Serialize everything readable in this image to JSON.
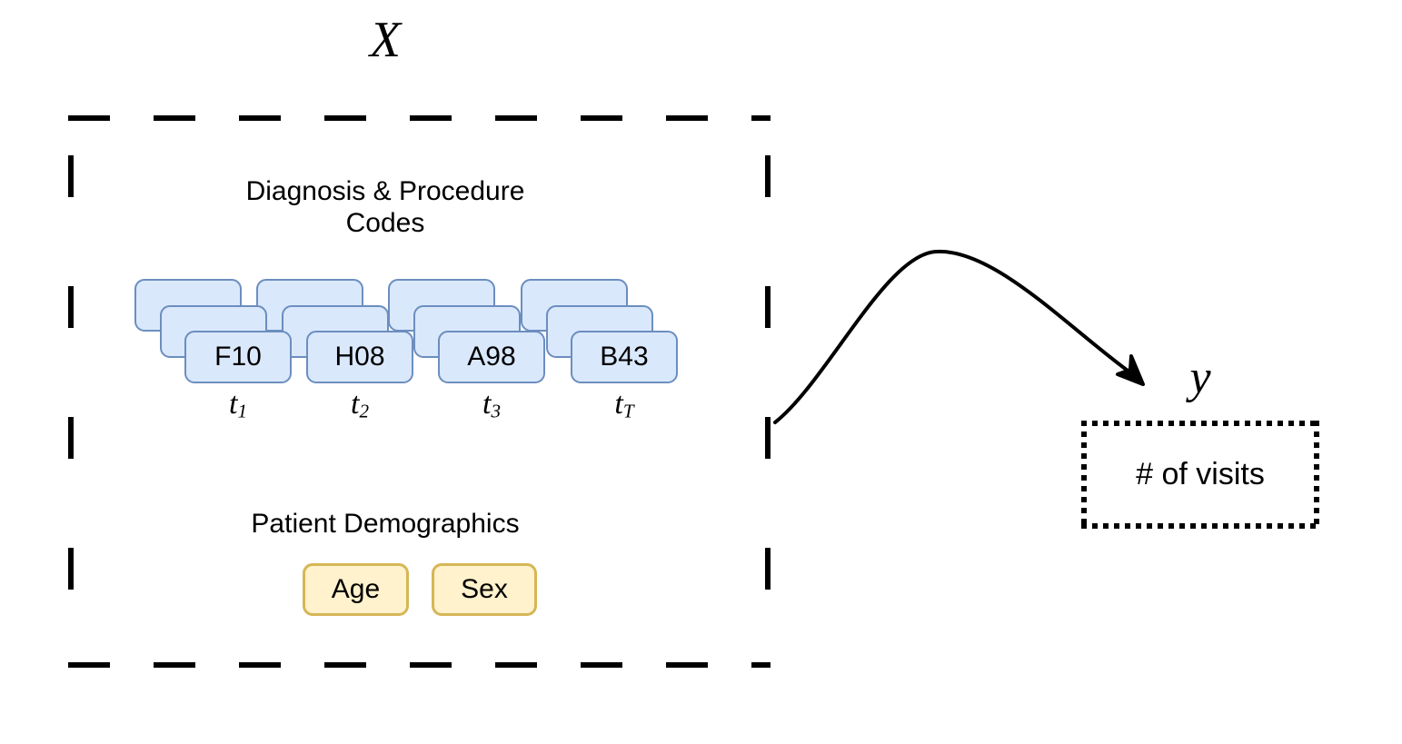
{
  "diagram": {
    "input": {
      "symbol": "X",
      "codes_section": {
        "heading_line1": "Diagnosis & Procedure",
        "heading_line2": "Codes",
        "stacks": [
          {
            "code": "F10",
            "step_t": "t",
            "step_sub": "1"
          },
          {
            "code": "H08",
            "step_t": "t",
            "step_sub": "2"
          },
          {
            "code": "A98",
            "step_t": "t",
            "step_sub": "3"
          },
          {
            "code": "B43",
            "step_t": "t",
            "step_sub": "T"
          }
        ]
      },
      "demographics_section": {
        "heading": "Patient Demographics",
        "chips": [
          {
            "label": "Age"
          },
          {
            "label": "Sex"
          }
        ]
      }
    },
    "output": {
      "symbol": "y",
      "label": "# of visits"
    },
    "colors": {
      "code_card_fill": "#dae8fc",
      "code_card_border": "#6c8ebf",
      "demo_chip_fill": "#fff2cc",
      "demo_chip_border": "#d6b656",
      "stroke": "#000000",
      "background": "#ffffff"
    }
  }
}
